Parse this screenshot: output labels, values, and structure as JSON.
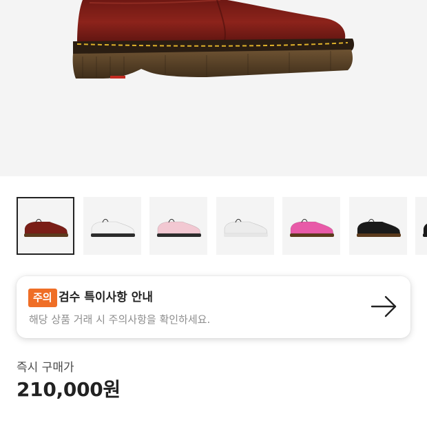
{
  "product_image": {
    "icon": "oxblood-derby-shoe-photo",
    "background": "#f4f4f4"
  },
  "color_options": [
    {
      "name": "thumb-cherry-red",
      "color": "#7a1e17",
      "sole": "#5b3a1c",
      "selected": true
    },
    {
      "name": "thumb-white",
      "color": "#f2f2f2",
      "sole": "#2b2b2b",
      "selected": false
    },
    {
      "name": "thumb-pale-pink",
      "color": "#f2c8d2",
      "sole": "#2b2b2b",
      "selected": false
    },
    {
      "name": "thumb-off-white",
      "color": "#ececec",
      "sole": "#e6e6e6",
      "selected": false
    },
    {
      "name": "thumb-hot-pink",
      "color": "#e85aa8",
      "sole": "#5b3a1c",
      "selected": false
    },
    {
      "name": "thumb-black",
      "color": "#1a1a1a",
      "sole": "#5b3a1c",
      "selected": false
    },
    {
      "name": "thumb-black-partial",
      "color": "#1a1a1a",
      "sole": "#1a1a1a",
      "selected": false
    }
  ],
  "notice": {
    "badge": "주의",
    "title": "검수 특이사항 안내",
    "subtitle": "해당 상품 거래 시 주의사항을 확인하세요.",
    "arrow_icon": "arrow-right-icon",
    "badge_color": "#ef6e26"
  },
  "price": {
    "label": "즉시 구매가",
    "value": "210,000원"
  }
}
